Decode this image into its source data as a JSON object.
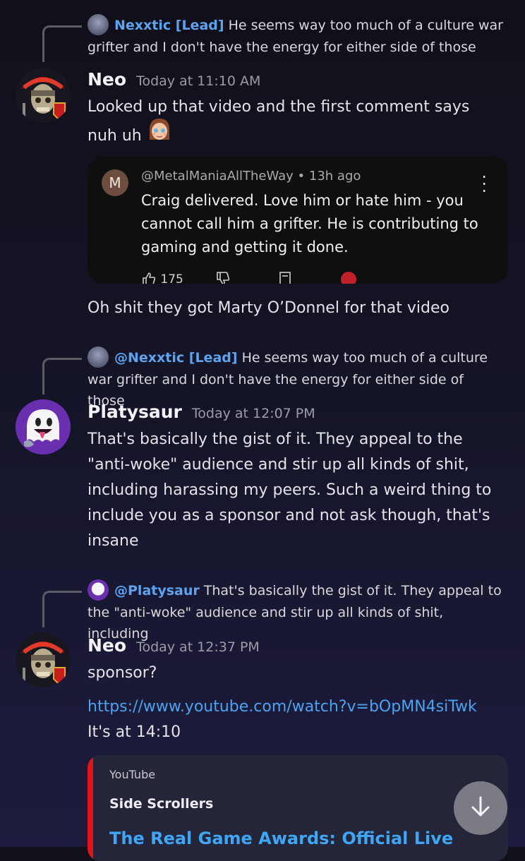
{
  "messages": [
    {
      "reply": {
        "name": "Nexxtic [Lead]",
        "text": "He seems way too much of a culture war grifter and I don't have the energy for either side of those"
      },
      "author": "Neo",
      "time": "Today at 11:10 AM",
      "lines": [
        "Looked up that video and the first comment says nuh uh"
      ],
      "embed": {
        "avatar_letter": "M",
        "handle": "@MetalManiaAllTheWay • 13h ago",
        "text": "Craig delivered. Love him or hate him - you cannot call him a grifter. He is contributing to gaming and getting it done.",
        "likes": "175"
      },
      "followup": "Oh shit they got Marty O’Donnel for that video"
    },
    {
      "reply": {
        "name": "@Nexxtic [Lead]",
        "text": "He seems way too much of a culture war grifter and I don't have the energy for either side of those"
      },
      "author": "Platysaur",
      "time": "Today at 12:07 PM",
      "text": "That's basically the gist of it. They appeal to the \"anti-woke\" audience and stir up all kinds of shit, including harassing my peers. Such a weird thing to include you as a sponsor and not ask though, that's insane"
    },
    {
      "reply": {
        "name": "@Platysaur",
        "text": "That's basically the gist of it. They appeal to the \"anti-woke\" audience and stir up all kinds of shit, including"
      },
      "author": "Neo",
      "time": "Today at 12:37 PM",
      "text": "sponsor?",
      "link": "https://www.youtube.com/watch?v=bOpMN4siTwk",
      "after_link": " It's at 14:10",
      "link_embed": {
        "provider": "YouTube",
        "author": "Side Scrollers",
        "title": "The Real Game Awards: Official Live"
      }
    }
  ],
  "colors": {
    "link": "#4aa3f3",
    "reply_name": "#5ea3f0",
    "embed_bar": "#e0141a"
  },
  "icons": [
    "arrow-down-icon",
    "thumbs-up-icon",
    "thumbs-down-icon",
    "more-options-icon"
  ]
}
